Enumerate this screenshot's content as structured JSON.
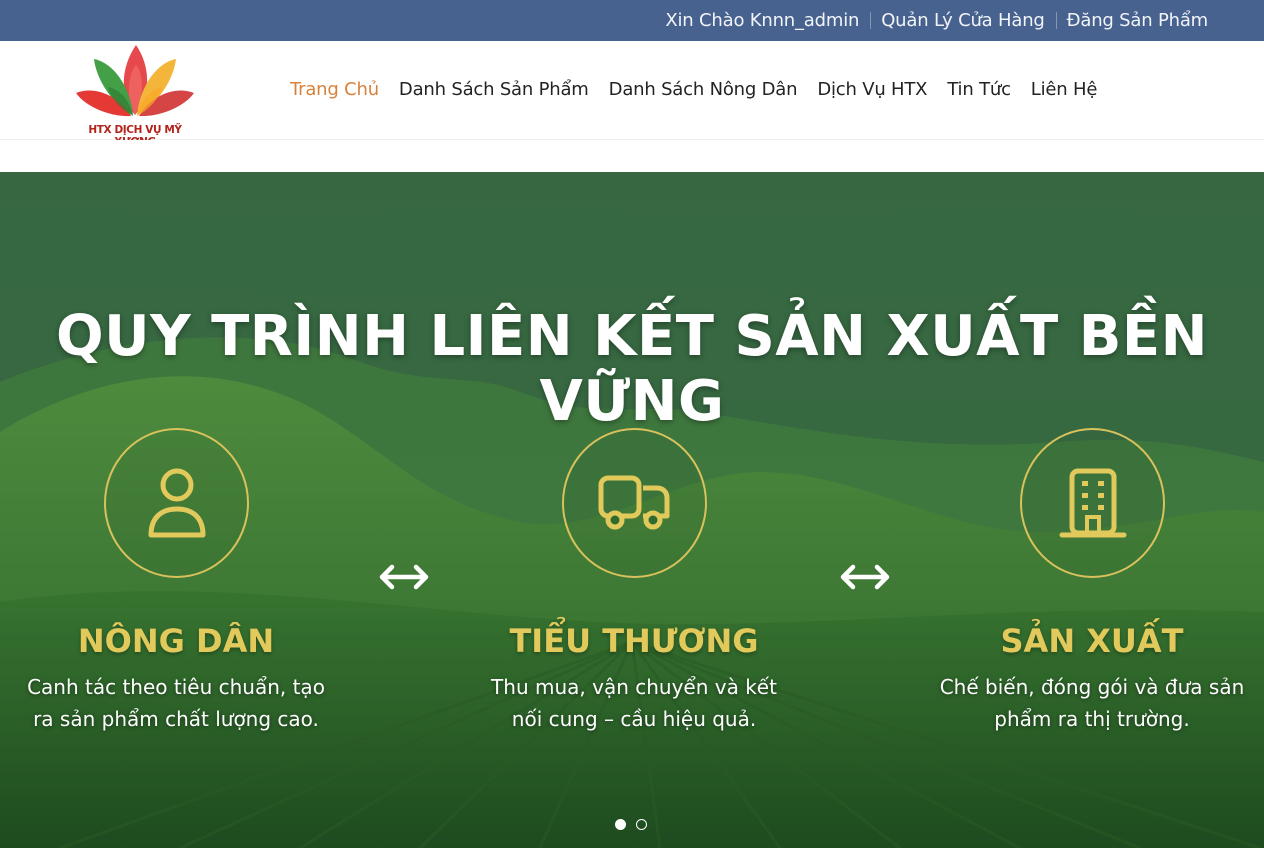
{
  "topbar": {
    "greeting": "Xin Chào Knnn_admin",
    "manage_store": "Quản Lý Cửa Hàng",
    "post_product": "Đăng Sản Phẩm"
  },
  "logo": {
    "text": "HTX DỊCH VỤ MỸ XƯƠNG"
  },
  "nav": {
    "items": [
      {
        "label": "Trang Chủ",
        "active": true
      },
      {
        "label": "Danh Sách Sản Phẩm"
      },
      {
        "label": "Danh Sách Nông Dân"
      },
      {
        "label": "Dịch Vụ HTX"
      },
      {
        "label": "Tin Tức"
      },
      {
        "label": "Liên Hệ"
      }
    ]
  },
  "hero": {
    "title": "QUY TRÌNH LIÊN KẾT SẢN XUẤT BỀN VỮNG",
    "steps": [
      {
        "icon": "user-icon",
        "title": "NÔNG DÂN",
        "desc_line1": "Canh tác theo tiêu chuẩn, tạo",
        "desc_line2": "ra sản phẩm chất lượng cao."
      },
      {
        "icon": "truck-icon",
        "title": "TIỂU THƯƠNG",
        "desc_line1": "Thu mua, vận chuyển và kết",
        "desc_line2": "nối cung – cầu hiệu quả."
      },
      {
        "icon": "building-icon",
        "title": "SẢN XUẤT",
        "desc_line1": "Chế biến, đóng gói và đưa sản",
        "desc_line2": "phẩm ra thị trường."
      }
    ],
    "slider": {
      "active_slide": 1,
      "total_slides": 2
    }
  },
  "colors": {
    "topbar_bg": "#47628f",
    "nav_active": "#d9813a",
    "accent_gold": "#e2c95c",
    "logo_text": "#b3241d"
  }
}
